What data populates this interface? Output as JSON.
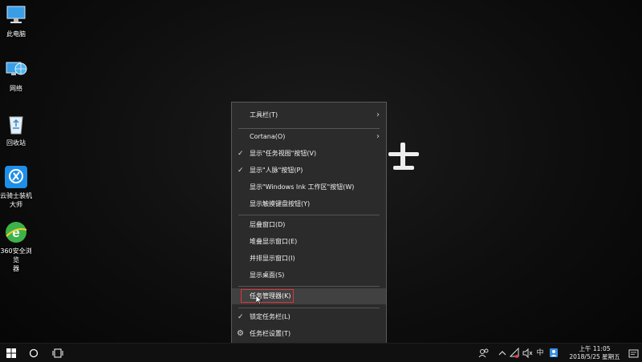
{
  "desktop": {
    "icons": [
      {
        "label": "此电脑",
        "icon": "computer-icon"
      },
      {
        "label": "网络",
        "icon": "network-icon"
      },
      {
        "label": "回收站",
        "icon": "recycle-bin-icon"
      },
      {
        "label": "云骑士装机\n大师",
        "icon": "yunqishi-icon"
      },
      {
        "label": "360安全浏览\n器",
        "icon": "360-browser-icon"
      }
    ]
  },
  "context_menu": {
    "items": [
      {
        "label": "工具栏(T)",
        "checked": false,
        "submenu": true
      },
      {
        "label": "Cortana(O)",
        "checked": false,
        "submenu": true
      },
      {
        "label": "显示\"任务视图\"按钮(V)",
        "checked": true
      },
      {
        "label": "显示\"人脉\"按钮(P)",
        "checked": true
      },
      {
        "label": "显示\"Windows Ink 工作区\"按钮(W)",
        "checked": false
      },
      {
        "label": "显示触摸键盘按钮(Y)",
        "checked": false
      },
      {
        "label": "层叠窗口(D)",
        "checked": false
      },
      {
        "label": "堆叠显示窗口(E)",
        "checked": false
      },
      {
        "label": "并排显示窗口(I)",
        "checked": false
      },
      {
        "label": "显示桌面(S)",
        "checked": false
      },
      {
        "label": "任务管理器(K)",
        "checked": false,
        "highlighted": true
      },
      {
        "label": "锁定任务栏(L)",
        "checked": true
      },
      {
        "label": "任务栏设置(T)",
        "checked": false,
        "icon": "gear-icon"
      }
    ],
    "check_glyph": "✓",
    "submenu_glyph": "›",
    "gear_glyph": "⚙"
  },
  "taskbar": {
    "ime": "中",
    "clock_time": "上午 11:05",
    "clock_date": "2018/5/25 星期五"
  }
}
